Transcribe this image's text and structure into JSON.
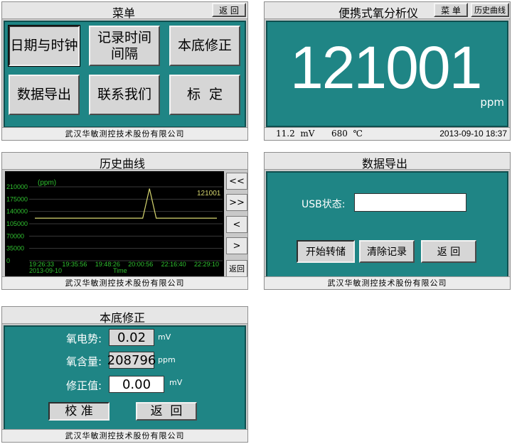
{
  "menu_panel": {
    "title": "菜单",
    "back_label": "返 回",
    "buttons": [
      "日期与时钟",
      "记录时间间隔",
      "本底修正",
      "数据导出",
      "联系我们",
      "标  定"
    ],
    "footer": "武汉华敏测控技术股份有限公司"
  },
  "analyzer_panel": {
    "title": "便携式氧分析仪",
    "menu_label": "菜 单",
    "history_label": "历史曲线",
    "reading": "121001",
    "unit": "ppm",
    "status_voltage": "11.2  mV",
    "status_temp": "680  ℃",
    "status_datetime": "2013-09-10 18:37"
  },
  "history_panel": {
    "title": "历史曲线",
    "nav": [
      "<<",
      ">>",
      "<",
      ">",
      "返回"
    ],
    "footer": "武汉华敏测控技术股份有限公司",
    "chart_data": {
      "type": "line",
      "ylabel": "(ppm)",
      "xlabel": "Time",
      "date_label": "2013-09-10",
      "y_ticks": [
        "210000",
        "175000",
        "140000",
        "105000",
        "70000",
        "35000",
        "0"
      ],
      "x_ticks": [
        "19:26:33",
        "19:35:56",
        "19:48:26",
        "20:00:56",
        "22:16:40",
        "22:29:10"
      ],
      "current_value_label": "121001",
      "ylim": [
        0,
        210000
      ],
      "series": [
        {
          "values": [
            121000,
            121000,
            121000,
            121000,
            121000,
            121000,
            121000,
            121000,
            121000,
            121000,
            121000,
            121000,
            121000,
            121000,
            121000,
            121000,
            121000,
            205000,
            121000,
            121000,
            121000,
            121000,
            121000,
            121000,
            121000,
            121000,
            121000,
            121000
          ]
        }
      ],
      "colors": {
        "line": "#d8d870",
        "axis_text": "#30c030",
        "value_label": "#d8d870",
        "background": "#000000"
      }
    }
  },
  "export_panel": {
    "title": "数据导出",
    "usb_label": "USB状态:",
    "usb_value": "",
    "start_label": "开始转储",
    "clear_label": "清除记录",
    "back_label": "返 回",
    "footer": "武汉华敏测控技术股份有限公司"
  },
  "correction_panel": {
    "title": "本底修正",
    "emf_label": "氧电势:",
    "emf_value": "0.02",
    "emf_unit": "mV",
    "content_label": "氧含量:",
    "content_value": "208796",
    "content_unit": "ppm",
    "corr_label": "修正值:",
    "corr_value": "0.00",
    "corr_unit": "mV",
    "calibrate_label": "校 准",
    "back_label": "返  回",
    "footer": "武汉华敏测控技术股份有限公司"
  }
}
